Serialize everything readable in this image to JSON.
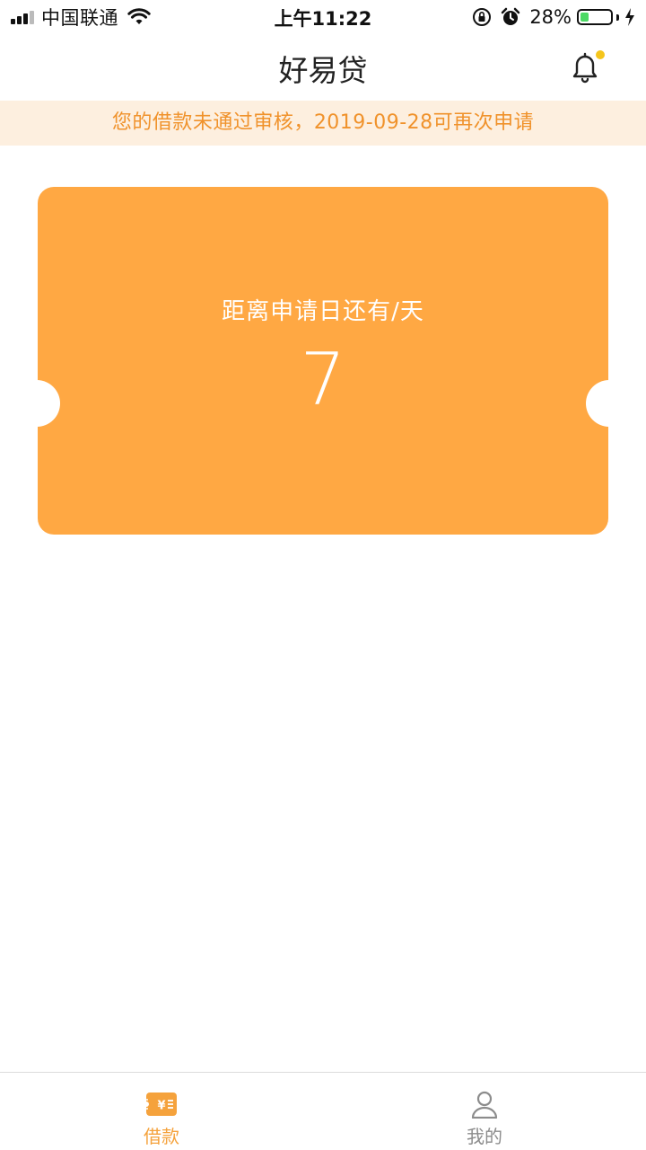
{
  "status_bar": {
    "carrier": "中国联通",
    "time": "上午11:22",
    "battery_percent": "28%",
    "battery_level": 0.28,
    "icons": [
      "signal-icon",
      "wifi-icon",
      "rotation-lock-icon",
      "alarm-icon",
      "battery-icon",
      "charging-icon"
    ]
  },
  "nav": {
    "title": "好易贷",
    "bell_icon": "bell-icon",
    "has_notification_dot": true
  },
  "notice": {
    "text": "您的借款未通过审核，2019-09-28可再次申请"
  },
  "ticket": {
    "label": "距离申请日还有/天",
    "value": "7"
  },
  "tabs": [
    {
      "label": "借款",
      "icon": "loan-ticket-icon",
      "active": true
    },
    {
      "label": "我的",
      "icon": "user-icon",
      "active": false
    }
  ],
  "colors": {
    "accent": "#ffa843",
    "notice_bg": "#fdefdf",
    "notice_text": "#f0922b",
    "tab_active": "#f5a23c",
    "tab_inactive": "#8c8c8c",
    "notification_dot": "#f5c51b",
    "battery_fill": "#4cd964"
  }
}
